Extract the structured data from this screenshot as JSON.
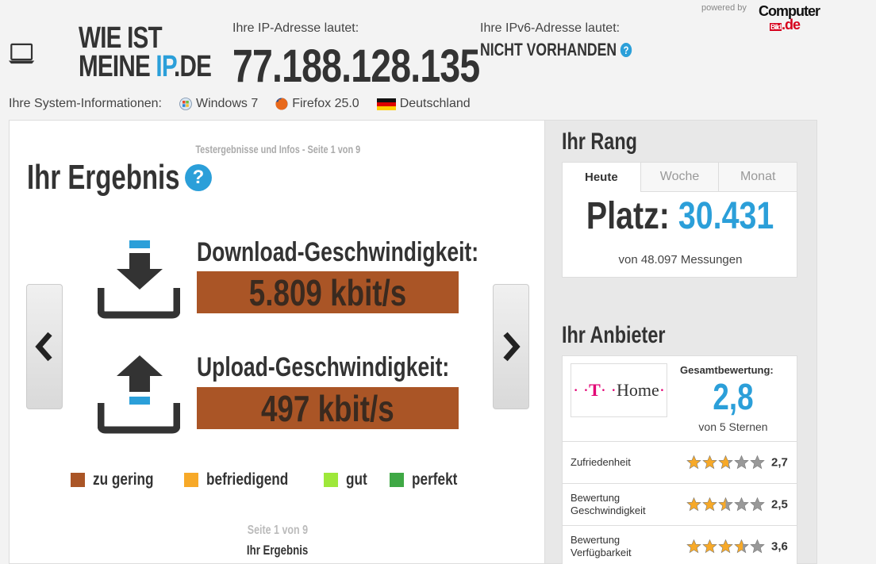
{
  "header": {
    "logo_line1": "WIE IST",
    "logo_line2a": "MEINE ",
    "logo_line2b": "IP",
    "logo_line2c": ".DE",
    "ip_label": "Ihre IP-Adresse lautet:",
    "ip_value": "77.188.128.135",
    "ipv6_label": "Ihre IPv6-Adresse lautet:",
    "ipv6_value": "NICHT VORHANDEN",
    "help_glyph": "?",
    "powered_by": "powered by",
    "partner_top": "Computer",
    "partner_bild": "Bild",
    "partner_de": ".de"
  },
  "system_info": {
    "label": "Ihre System-Informationen:",
    "os": "Windows 7",
    "browser": "Firefox 25.0",
    "country": "Deutschland"
  },
  "main": {
    "page_info": "Testergebnisse und Infos - Seite 1 von 9",
    "title": "Ihr Ergebnis",
    "download_label": "Download-Geschwindigkeit:",
    "download_value": "5.809 kbit/s",
    "upload_label": "Upload-Geschwindigkeit:",
    "upload_value": "497 kbit/s",
    "legend": [
      {
        "label": "zu gering",
        "color": "#aa5526"
      },
      {
        "label": "befriedigend",
        "color": "#f7a928"
      },
      {
        "label": "gut",
        "color": "#9ee83a"
      },
      {
        "label": "perfekt",
        "color": "#3fa845"
      }
    ],
    "footer_page": "Seite 1 von 9",
    "footer_title": "Ihr Ergebnis"
  },
  "rank": {
    "title": "Ihr Rang",
    "tabs": [
      "Heute",
      "Woche",
      "Monat"
    ],
    "active_tab": 0,
    "platz_label": "Platz: ",
    "platz_value": "30.431",
    "sub": "von 48.097 Messungen"
  },
  "provider": {
    "title": "Ihr Anbieter",
    "logo_dots_left": "· · ",
    "logo_t": "T",
    "logo_dots_mid": " · ·",
    "logo_home": "Home",
    "logo_dot_right": "·",
    "overall_label": "Gesamtbewertung:",
    "overall_value": "2,8",
    "overall_sub": "von 5 Sternen",
    "ratings": [
      {
        "label": "Zufriedenheit",
        "value": "2,7",
        "stars": 2.7
      },
      {
        "label": "Bewertung Geschwindigkeit",
        "value": "2,5",
        "stars": 2.5
      },
      {
        "label": "Bewertung Verfügbarkeit",
        "value": "3,6",
        "stars": 3.6
      }
    ]
  },
  "colors": {
    "accent": "#2b9fd9",
    "bar": "#aa5526",
    "star": "#f7a928",
    "magenta": "#e20074"
  }
}
